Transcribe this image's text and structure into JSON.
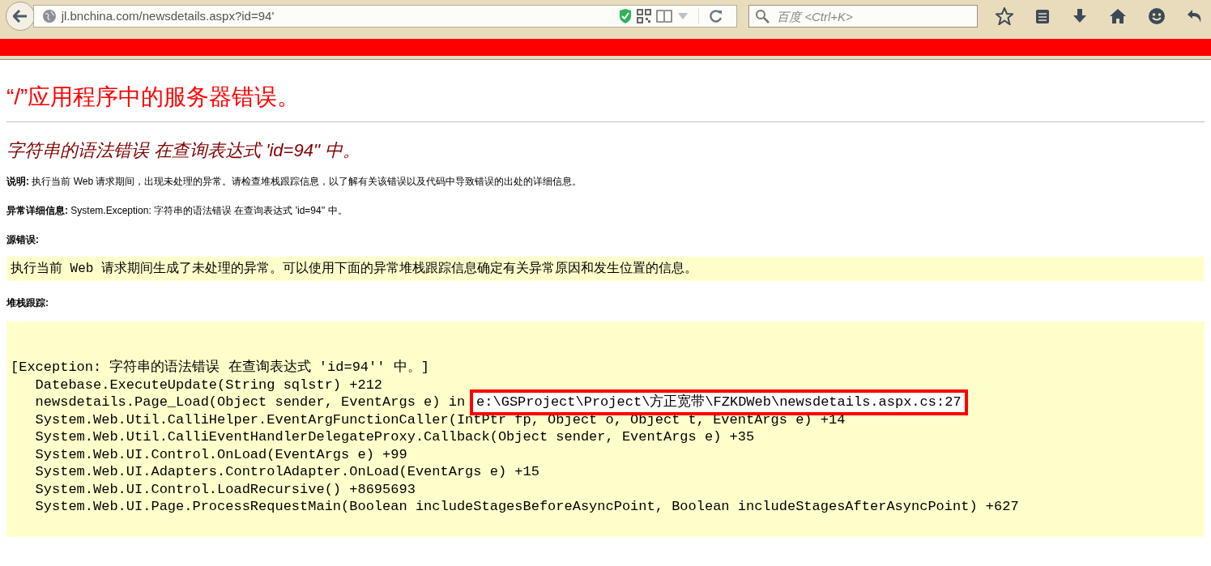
{
  "browser": {
    "url": "jl.bnchina.com/newsdetails.aspx?id=94'",
    "search_placeholder": "百度 <Ctrl+K>"
  },
  "page": {
    "title": "“/”应用程序中的服务器错误。",
    "subtitle": "字符串的语法错误 在查询表达式 'id=94'' 中。",
    "description": {
      "label": "说明:",
      "text": "执行当前 Web 请求期间，出现未处理的异常。请检查堆栈跟踪信息，以了解有关该错误以及代码中导致错误的出处的详细信息。"
    },
    "details": {
      "label": "异常详细信息:",
      "text": "System.Exception: 字符串的语法错误 在查询表达式 'id=94'' 中。"
    },
    "source_error": {
      "label": "源错误:",
      "code": "执行当前 Web 请求期间生成了未处理的异常。可以使用下面的异常堆栈跟踪信息确定有关异常原因和发生位置的信息。"
    },
    "stack_trace": {
      "label": "堆栈跟踪:",
      "lines": [
        {
          "text": "[Exception: 字符串的语法错误 在查询表达式 'id=94'' 中。]"
        },
        {
          "text": "   Datebase.ExecuteUpdate(String sqlstr) +212"
        },
        {
          "text": "   newsdetails.Page_Load(Object sender, EventArgs e) in",
          "boxed": "e:\\GSProject\\Project\\方正宽带\\FZKDWeb\\newsdetails.aspx.cs:27"
        },
        {
          "text": "   System.Web.Util.CalliHelper.EventArgFunctionCaller(IntPtr fp, Object o, Object t, EventArgs e) +14"
        },
        {
          "text": "   System.Web.Util.CalliEventHandlerDelegateProxy.Callback(Object sender, EventArgs e) +35"
        },
        {
          "text": "   System.Web.UI.Control.OnLoad(EventArgs e) +99"
        },
        {
          "text": "   System.Web.UI.Adapters.ControlAdapter.OnLoad(EventArgs e) +15"
        },
        {
          "text": "   System.Web.UI.Control.LoadRecursive() +8695693"
        },
        {
          "text": "   System.Web.UI.Page.ProcessRequestMain(Boolean includeStagesBeforeAsyncPoint, Boolean includeStagesAfterAsyncPoint) +627"
        }
      ]
    }
  }
}
